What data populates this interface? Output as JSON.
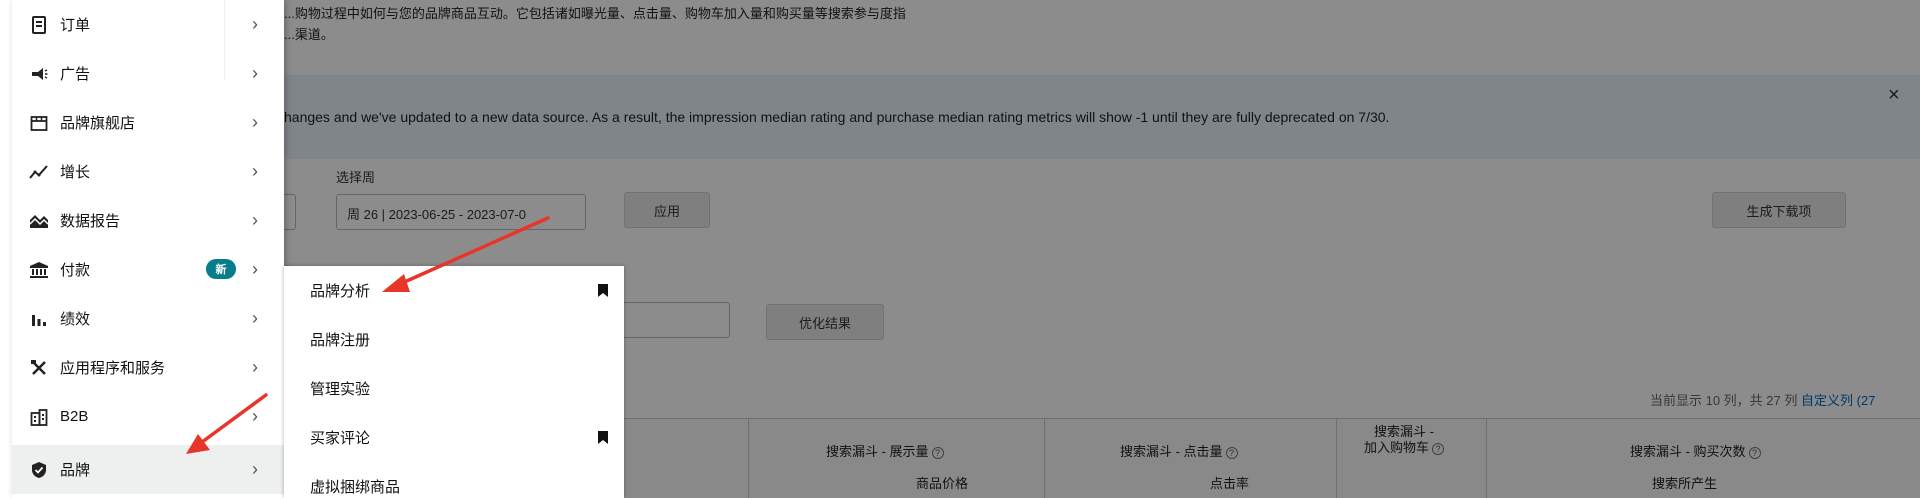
{
  "background": {
    "description_line1": "...购物过程中如何与您的品牌商品互动。它包括诸如曝光量、点击量、购物车加入量和购买量等搜索参与度指",
    "description_line2": "...渠道。",
    "notice_text": "hanges and we've updated to a new data source. As a result, the impression median rating and purchase median rating metrics will show -1 until they are fully deprecated on 7/30.",
    "notice_close": "×",
    "select_week_label": "选择周",
    "select_week_value": "周 26 | 2023-06-25 - 2023-07-0",
    "apply_button": "应用",
    "generate_download_button": "生成下载项",
    "optimize_results_button": "优化结果",
    "columns_info": "当前显示 10 列，共 27 列",
    "customize_columns_link": "自定义列 (27",
    "table_headers": {
      "impressions": "搜索漏斗 - 展示量",
      "clicks": "搜索漏斗 - 点击量",
      "add_to_cart_line1": "搜索漏斗 -",
      "add_to_cart_line2": "加入购物车",
      "purchases": "搜索漏斗 - 购买次数",
      "product_price": "商品价格",
      "click_rate": "点击率",
      "search_generated": "搜索所产生"
    }
  },
  "nav": {
    "items": [
      {
        "label": "订单",
        "icon": "orders-icon"
      },
      {
        "label": "广告",
        "icon": "megaphone-icon"
      },
      {
        "label": "品牌旗舰店",
        "icon": "storefront-icon"
      },
      {
        "label": "增长",
        "icon": "growth-icon"
      },
      {
        "label": "数据报告",
        "icon": "data-report-icon"
      },
      {
        "label": "付款",
        "icon": "bank-icon",
        "badge": "新"
      },
      {
        "label": "绩效",
        "icon": "bar-chart-icon"
      },
      {
        "label": "应用程序和服务",
        "icon": "tools-icon"
      },
      {
        "label": "B2B",
        "icon": "building-icon"
      },
      {
        "label": "品牌",
        "icon": "shield-icon"
      }
    ],
    "active_item": "品牌"
  },
  "submenu": {
    "items": [
      {
        "label": "品牌分析",
        "bookmarked": true
      },
      {
        "label": "品牌注册",
        "bookmarked": false
      },
      {
        "label": "管理实验",
        "bookmarked": false
      },
      {
        "label": "买家评论",
        "bookmarked": true
      },
      {
        "label": "虚拟捆绑商品",
        "bookmarked": false
      }
    ]
  },
  "colors": {
    "accent_arrow": "#e8352a",
    "badge_bg": "#067d8a",
    "link": "#0066c0"
  }
}
